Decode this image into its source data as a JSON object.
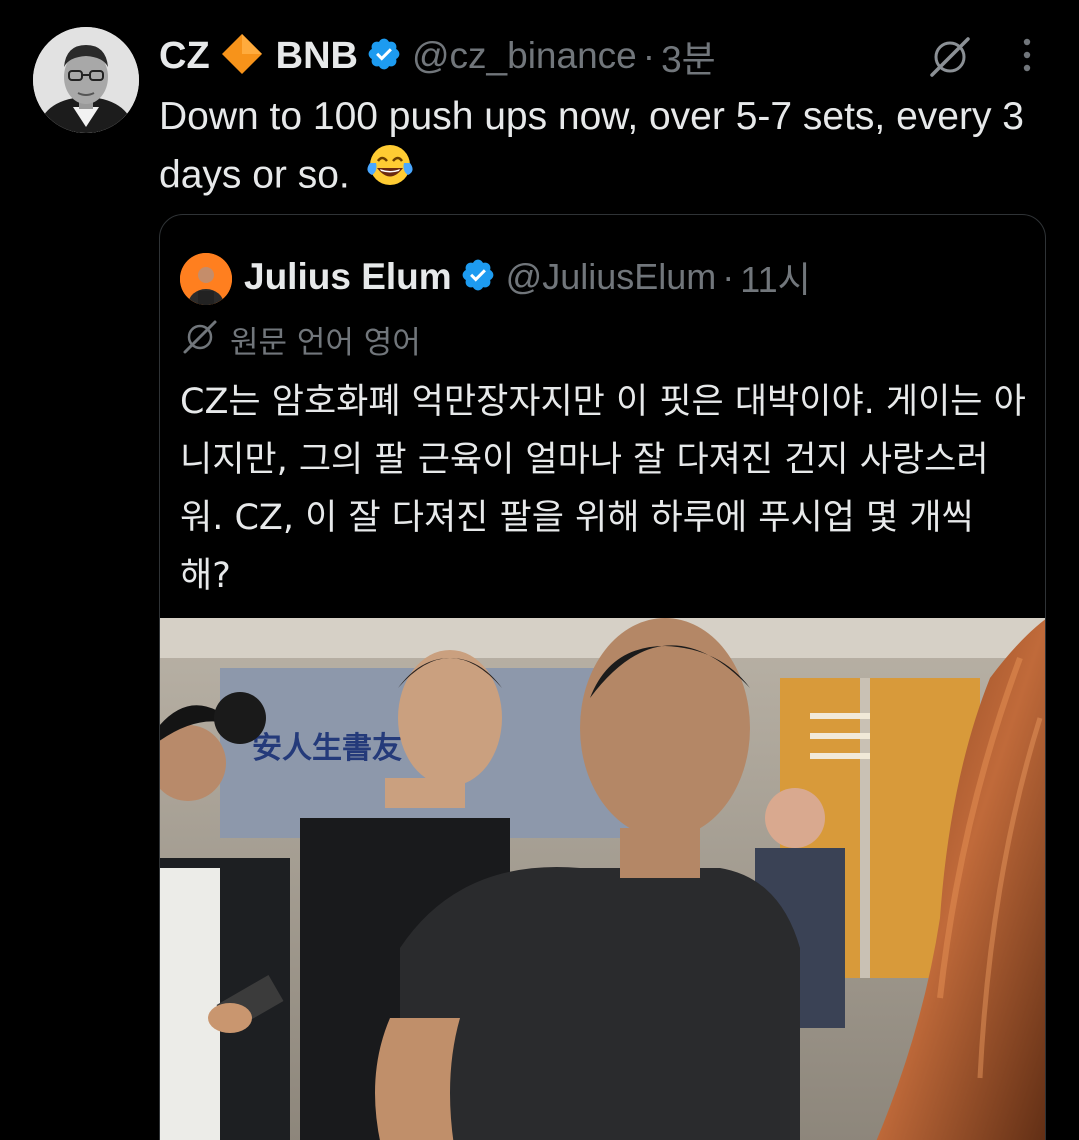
{
  "tweet": {
    "display_name": "CZ",
    "badge_name": "BNB",
    "handle": "@cz_binance",
    "separator": "·",
    "time": "3분",
    "text": "Down to 100 push ups now, over 5-7 sets, every 3 days or so.",
    "emoji": "face-with-tears-of-joy"
  },
  "quoted_tweet": {
    "display_name": "Julius Elum",
    "handle": "@JuliusElum",
    "separator": "·",
    "time": "11시",
    "translate_label": "원문 언어 영어",
    "text": "CZ는 암호화폐 억만장자지만 이 핏은 대박이야. 게이는 아니지만, 그의 팔 근육이 얼마나 잘 다져진 건지 사랑스러워. CZ, 이 잘 다져진 팔을 위해 하루에 푸시업 몇 개씩 해?",
    "media_sign_text": "安人生書友"
  },
  "colors": {
    "background": "#000000",
    "primary_text": "#e7e9ea",
    "secondary_text": "#71767b",
    "verified_blue": "#1d9bf0",
    "bnb_orange": "#f0b90b",
    "border": "#2f3336"
  },
  "icons": {
    "verified": "verified-badge-icon",
    "diamond": "bnb-diamond-icon",
    "grok": "grok-icon",
    "more": "more-icon",
    "translate": "translate-icon"
  }
}
